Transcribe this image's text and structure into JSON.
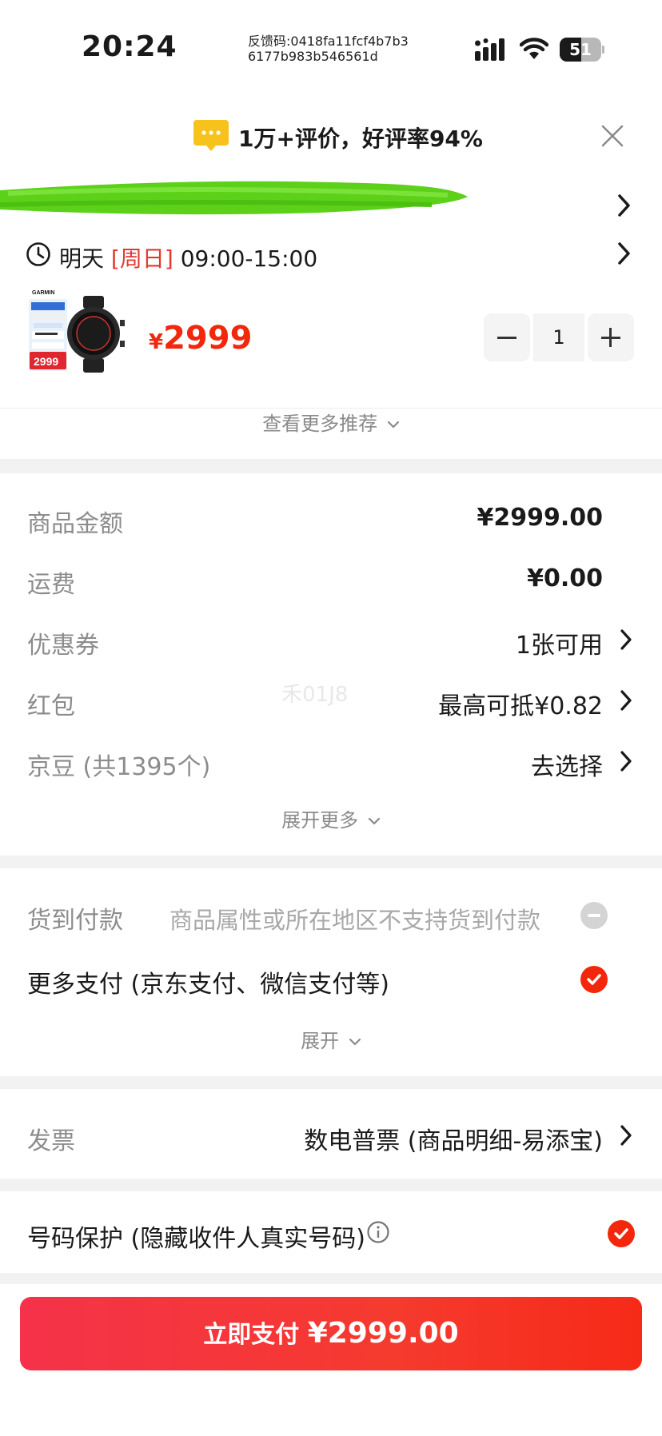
{
  "status_bar": {
    "time": "20:24",
    "feedback_line1": "反馈码:0418fa11fcf4b7b3",
    "feedback_line2": "6177b983b546561d",
    "battery": "51"
  },
  "header": {
    "rating_text": "1万+评价，好评率94%"
  },
  "delivery": {
    "day": "明天",
    "weekday": "[周日]",
    "time_range": "09:00-15:00"
  },
  "product": {
    "image_brand": "GARMIN",
    "image_price": "2999",
    "currency": "¥",
    "price": "2999",
    "quantity": "1"
  },
  "more_recommend": "查看更多推荐",
  "fees": [
    {
      "label": "商品金额",
      "value": "¥2999.00"
    },
    {
      "label": "运费",
      "value": "¥0.00"
    },
    {
      "label": "优惠券",
      "value": "1张可用"
    },
    {
      "label": "红包",
      "value": "最高可抵¥0.82"
    },
    {
      "label": "京豆 (共1395个)",
      "value": "去选择"
    }
  ],
  "watermark": "禾01J8",
  "expand_more": "展开更多",
  "payment": {
    "cod_label": "货到付款",
    "cod_note": "商品属性或所在地区不支持货到付款",
    "more_label": "更多支付 (京东支付、微信支付等)",
    "expand": "展开"
  },
  "invoice": {
    "label": "发票",
    "value": "数电普票 (商品明细-易添宝)"
  },
  "protection": {
    "label": "号码保护 (隐藏收件人真实号码)"
  },
  "pay_button": {
    "label": "立即支付",
    "amount": "¥2999.00"
  },
  "colors": {
    "accent_red": "#f2270c",
    "label_grey": "#8c8c8c",
    "divider": "#f2f2f2"
  }
}
